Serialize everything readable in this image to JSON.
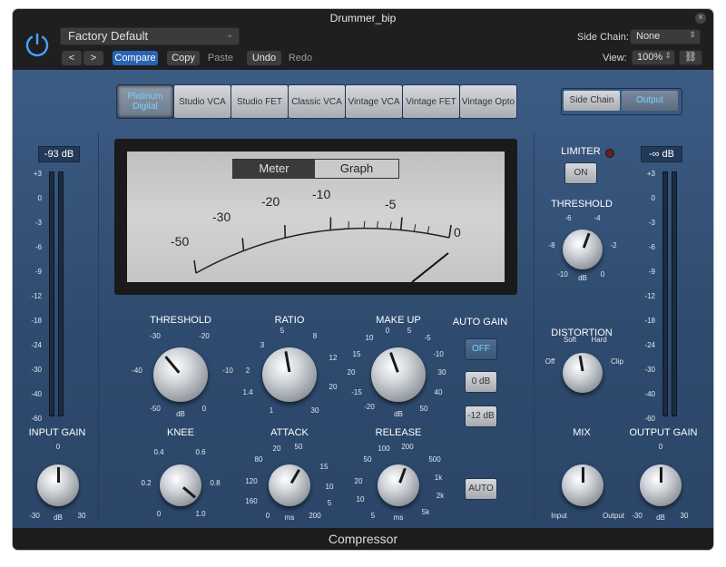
{
  "window": {
    "title": "Drummer_bip"
  },
  "toolbar": {
    "preset": "Factory Default",
    "prev": "<",
    "next": ">",
    "compare": "Compare",
    "copy": "Copy",
    "paste": "Paste",
    "undo": "Undo",
    "redo": "Redo",
    "side_chain_label": "Side Chain:",
    "side_chain_value": "None",
    "view_label": "View:",
    "view_value": "100%"
  },
  "models": [
    "Platinum Digital",
    "Studio VCA",
    "Studio FET",
    "Classic VCA",
    "Vintage VCA",
    "Vintage FET",
    "Vintage Opto"
  ],
  "models_selected": 0,
  "meter_tabs": {
    "meter": "Meter",
    "graph": "Graph"
  },
  "right_tabs": {
    "side_chain": "Side Chain",
    "output": "Output"
  },
  "vu_labels": [
    "-50",
    "-30",
    "-20",
    "-10",
    "-5",
    "0"
  ],
  "input_meter": {
    "readout": "-93 dB",
    "scale": [
      "+3",
      "0",
      "-3",
      "-6",
      "-9",
      "-12",
      "-18",
      "-24",
      "-30",
      "-40",
      "-60"
    ]
  },
  "output_meter": {
    "readout": "-∞ dB",
    "scale": [
      "+3",
      "0",
      "-3",
      "-6",
      "-9",
      "-12",
      "-18",
      "-24",
      "-30",
      "-40",
      "-60"
    ]
  },
  "threshold": {
    "label": "THRESHOLD",
    "ticks": [
      "-30",
      "-20",
      "-40",
      "-10",
      "-50",
      "dB",
      "0"
    ]
  },
  "ratio": {
    "label": "RATIO",
    "ticks": [
      "5",
      "8",
      "3",
      "12",
      "2",
      "20",
      "1.4",
      "1",
      "30"
    ]
  },
  "makeup": {
    "label": "MAKE UP",
    "ticks": [
      "0",
      "5",
      "10",
      "-5",
      "15",
      "-10",
      "20",
      "30",
      "-15",
      "40",
      "-20",
      "dB",
      "50"
    ]
  },
  "auto_gain": {
    "label": "AUTO GAIN",
    "off": "OFF",
    "zero": "0 dB",
    "minus12": "-12 dB"
  },
  "knee": {
    "label": "KNEE",
    "ticks": [
      "0.4",
      "0.6",
      "0.2",
      "0.8",
      "0",
      "1.0"
    ]
  },
  "attack": {
    "label": "ATTACK",
    "ticks": [
      "20",
      "50",
      "80",
      "15",
      "120",
      "10",
      "160",
      "5",
      "0",
      "ms",
      "200"
    ]
  },
  "release": {
    "label": "RELEASE",
    "ticks": [
      "100",
      "200",
      "50",
      "500",
      "20",
      "1k",
      "10",
      "2k",
      "5",
      "ms",
      "5k"
    ]
  },
  "auto_button": "AUTO",
  "input_gain": {
    "label": "INPUT GAIN",
    "ticks": [
      "0",
      "-30",
      "dB",
      "30"
    ]
  },
  "limiter": {
    "label": "LIMITER",
    "on": "ON",
    "threshold_label": "THRESHOLD",
    "ticks": [
      "-6",
      "-4",
      "-8",
      "-2",
      "-10",
      "dB",
      "0"
    ]
  },
  "distortion": {
    "label": "DISTORTION",
    "ticks": [
      "Soft",
      "Hard",
      "Off",
      "Clip"
    ]
  },
  "mix": {
    "label": "MIX",
    "ticks": [
      "Input",
      "Output"
    ]
  },
  "output_gain": {
    "label": "OUTPUT GAIN",
    "ticks": [
      "0",
      "-30",
      "dB",
      "30"
    ]
  },
  "footer": "Compressor"
}
